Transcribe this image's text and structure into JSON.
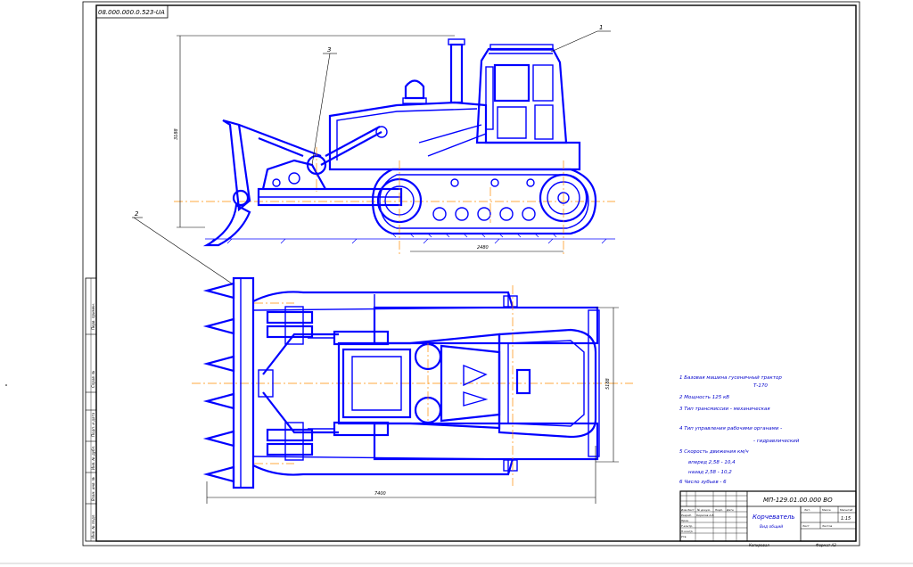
{
  "drawing_code_top": "08.000.000.0.523-UA",
  "callouts": [
    "1",
    "2",
    "3",
    "2"
  ],
  "dimensions": {
    "height_side": "3188",
    "track_base": "2480",
    "width_plan": "5188",
    "overall_length": "7400"
  },
  "spec_notes": [
    "1 Базовая машина гусеничный трактор",
    "Т-170",
    "2 Мощность        125 кВ",
    "3 Тип трансмиссии - механическая",
    "4 Тип управления рабочими органами -",
    "- гидравлический",
    "5 Скорость движения км/ч",
    "вперед  2,58 - 10,4",
    "назад   2,58 - 10,2",
    "6 Число зубьев - 6"
  ],
  "title_block": {
    "code": "МП-129.01.00.000 ВО",
    "title": "Корчеватель",
    "subtitle": "Вид общий",
    "scale": "1:15",
    "col_labels": [
      "Изм.",
      "Лист",
      "№ докум.",
      "Подп.",
      "Дата"
    ],
    "row_labels": [
      "Разраб.",
      "Пров.",
      "Т.контр.",
      "Н.контр.",
      "Утв."
    ],
    "rev_name": "Кирилов А.В.",
    "lit_labels": [
      "Лит.",
      "Масса",
      "Масштаб"
    ],
    "sheet_label": "Лист",
    "sheets_label": "Листов",
    "copied": "Копировал",
    "format": "Формат  А3"
  },
  "left_strip": [
    "Перв. примен.",
    "Справ. №",
    "Подп. и дата",
    "Инв. № дубл.",
    "Взам. инв. №",
    "Подп. и дата",
    "Инв. № подл."
  ],
  "colors": {
    "line": "#0000ff",
    "dimension": "#000000",
    "center": "#ff8c00"
  }
}
